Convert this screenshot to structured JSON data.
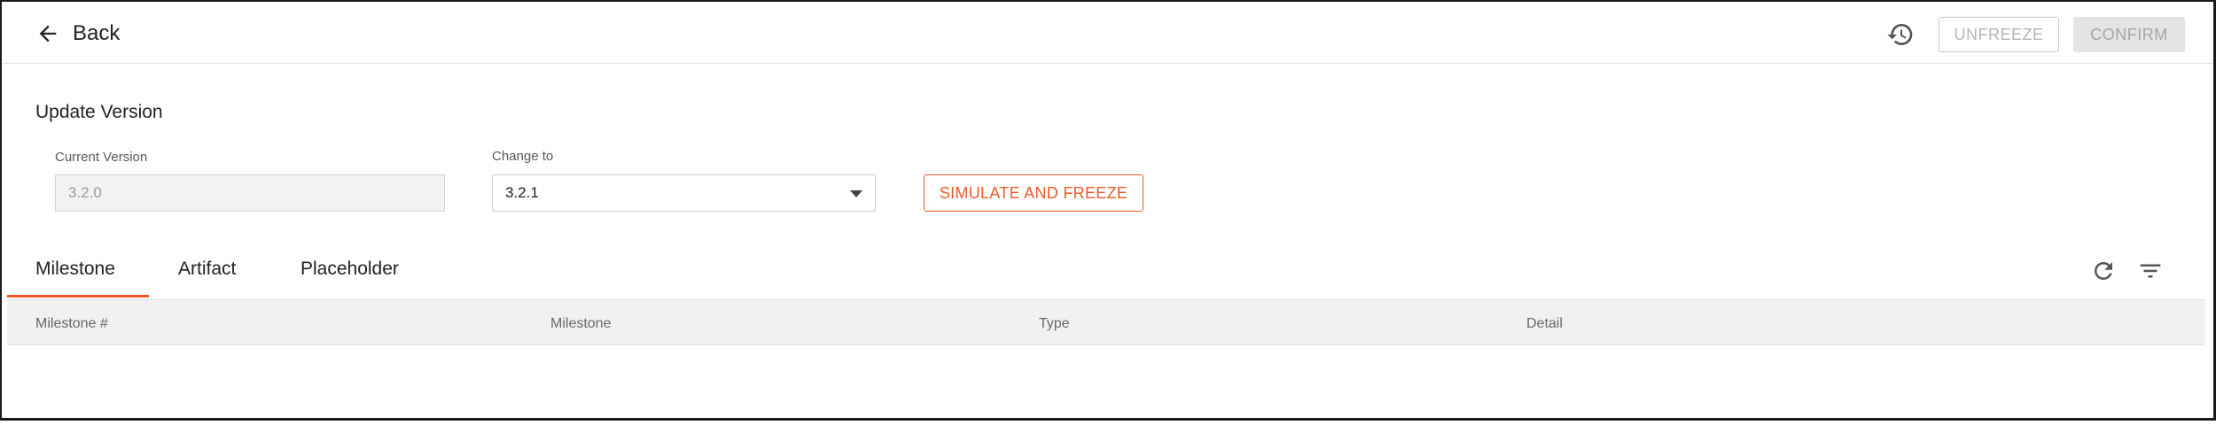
{
  "header": {
    "back_label": "Back",
    "history_icon": "history-icon",
    "unfreeze_label": "UNFREEZE",
    "confirm_label": "CONFIRM"
  },
  "update_version": {
    "title": "Update Version",
    "current_version_label": "Current Version",
    "current_version_value": "3.2.0",
    "change_to_label": "Change to",
    "change_to_value": "3.2.1",
    "simulate_label": "SIMULATE AND FREEZE"
  },
  "tabs": [
    {
      "label": "Milestone",
      "active": true
    },
    {
      "label": "Artifact",
      "active": false
    },
    {
      "label": "Placeholder",
      "active": false
    }
  ],
  "table": {
    "columns": [
      "Milestone #",
      "Milestone",
      "Type",
      "Detail"
    ],
    "rows": []
  },
  "colors": {
    "accent": "#f05a28",
    "disabled_text": "#a6a6a6",
    "header_bg": "#f1f1f1"
  }
}
